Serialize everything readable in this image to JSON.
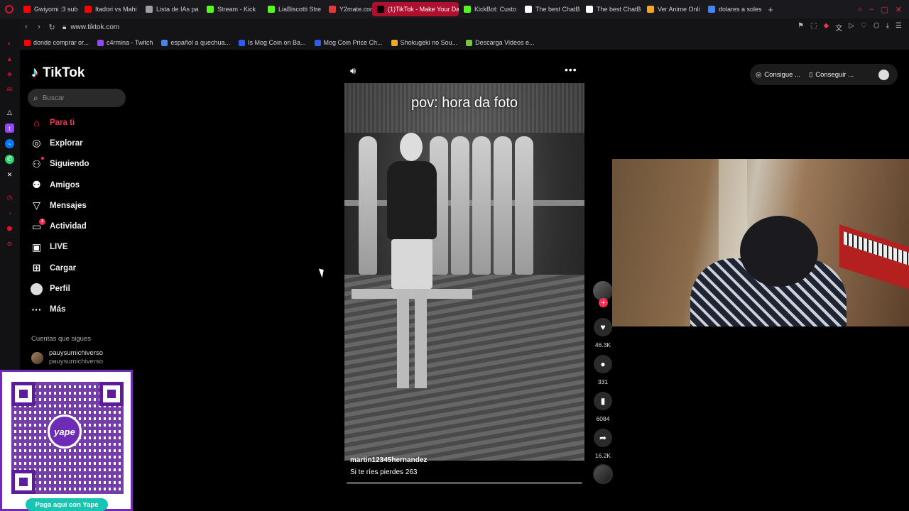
{
  "browser": {
    "tabs": [
      {
        "label": "Gwiyomi :3 sub",
        "color": "#ff0000",
        "active": false
      },
      {
        "label": "Itadori vs Mahi",
        "color": "#ff0000",
        "active": false
      },
      {
        "label": "Lista de IAs pa",
        "color": "#9aa0a6",
        "active": false
      },
      {
        "label": "Stream - Kick",
        "color": "#53fc18",
        "active": false
      },
      {
        "label": "LiaBiscotti Stre",
        "color": "#53fc18",
        "active": false
      },
      {
        "label": "Y2mate.com",
        "color": "#e53935",
        "active": false
      },
      {
        "label": "(1)TikTok - Make Your Da",
        "color": "#000000",
        "active": true
      },
      {
        "label": "KickBot: Custo",
        "color": "#53fc18",
        "active": false
      },
      {
        "label": "The best ChatB",
        "color": "#ffffff",
        "active": false
      },
      {
        "label": "The best ChatB",
        "color": "#ffffff",
        "active": false
      },
      {
        "label": "Ver Anime Onli",
        "color": "#f5a623",
        "active": false
      },
      {
        "label": "dolares a soles",
        "color": "#4285f4",
        "active": false
      }
    ],
    "new_tab": "+",
    "url": "www.tiktok.com",
    "bookmarks": [
      {
        "label": "donde comprar or...",
        "color": "#ff0000"
      },
      {
        "label": "c4rmina - Twitch",
        "color": "#9146ff"
      },
      {
        "label": "español a quechua...",
        "color": "#4285f4"
      },
      {
        "label": "Is Mog Coin on Ba...",
        "color": "#2f5cf0"
      },
      {
        "label": "Mog Coin Price Ch...",
        "color": "#2f5cf0"
      },
      {
        "label": "Shokugeki no Sou...",
        "color": "#f5a623"
      },
      {
        "label": "Descarga Videos e...",
        "color": "#7cc242"
      }
    ]
  },
  "tiktok": {
    "logo": "TikTok",
    "search_placeholder": "Buscar",
    "nav": [
      {
        "label": "Para ti",
        "icon": "home-icon",
        "glyph": "⌂",
        "active": true,
        "badge": ""
      },
      {
        "label": "Explorar",
        "icon": "compass-icon",
        "glyph": "◎",
        "active": false,
        "badge": ""
      },
      {
        "label": "Siguiendo",
        "icon": "following-icon",
        "glyph": "⚇",
        "active": false,
        "badge": "dot"
      },
      {
        "label": "Amigos",
        "icon": "friends-icon",
        "glyph": "⚉",
        "active": false,
        "badge": ""
      },
      {
        "label": "Mensajes",
        "icon": "messages-icon",
        "glyph": "▽",
        "active": false,
        "badge": ""
      },
      {
        "label": "Actividad",
        "icon": "activity-icon",
        "glyph": "▭",
        "active": false,
        "badge": "1"
      },
      {
        "label": "LIVE",
        "icon": "live-icon",
        "glyph": "▣",
        "active": false,
        "badge": ""
      },
      {
        "label": "Cargar",
        "icon": "upload-icon",
        "glyph": "⊞",
        "active": false,
        "badge": ""
      },
      {
        "label": "Perfil",
        "icon": "profile-avatar",
        "glyph": "",
        "active": false,
        "badge": ""
      },
      {
        "label": "Más",
        "icon": "more-icon",
        "glyph": "···",
        "active": false,
        "badge": ""
      }
    ],
    "following_title": "Cuentas que sigues",
    "following": [
      {
        "name": "pauysumichiverso",
        "username": "pauysumichiverso"
      }
    ],
    "video": {
      "caption": "pov: hora da foto",
      "username": "martin12345hernandez",
      "description": "Si te ríes pierdes 263",
      "progress": 0.0
    },
    "actions": {
      "likes": "46.3K",
      "comments": "331",
      "saves": "6084",
      "shares": "16.2K"
    },
    "top_pills": [
      {
        "label": "Consigue ...",
        "icon": "coin-icon"
      },
      {
        "label": "Conseguir ...",
        "icon": "phone-icon"
      }
    ]
  },
  "overlay": {
    "yape_logo": "yape",
    "yape_button": "Paga aquí con Yape"
  }
}
